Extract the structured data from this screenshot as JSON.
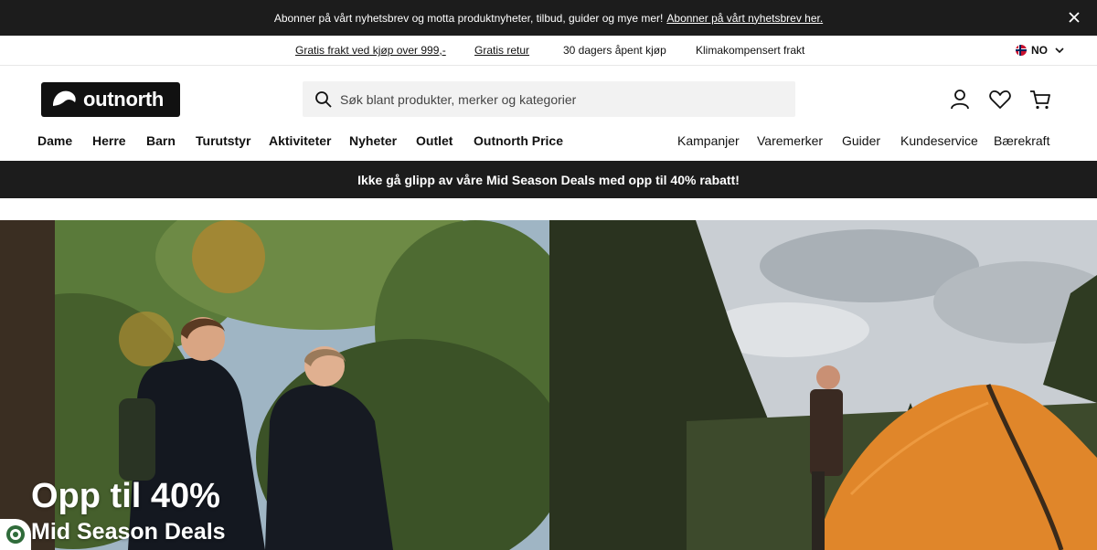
{
  "topbar": {
    "text": "Abonner på vårt nyhetsbrev og motta produktnyheter, tilbud, guider og mye mer!",
    "link": "Abonner på vårt nyhetsbrev her."
  },
  "usp": {
    "items": [
      "Gratis frakt ved kjøp over 999,-",
      "Gratis retur",
      "30 dagers åpent kjøp",
      "Klimakompensert frakt"
    ],
    "language": "NO"
  },
  "header": {
    "logo_text": "outnorth",
    "search_placeholder": "Søk blant produkter, merker og kategorier"
  },
  "nav": {
    "main": [
      "Dame",
      "Herre",
      "Barn",
      "Turutstyr",
      "Aktiviteter",
      "Nyheter",
      "Outlet",
      "Outnorth Price"
    ],
    "secondary": [
      "Kampanjer",
      "Varemerker",
      "Guider",
      "Kundeservice",
      "Bærekraft"
    ]
  },
  "promo": {
    "text": "Ikke gå glipp av våre Mid Season Deals med opp til 40% rabatt!"
  },
  "hero": {
    "title": "Opp til 40%",
    "subtitle": "Mid Season Deals"
  },
  "colors": {
    "dark": "#1c1c1c",
    "search_bg": "#f2f2f2",
    "tent": "#e0862a"
  }
}
